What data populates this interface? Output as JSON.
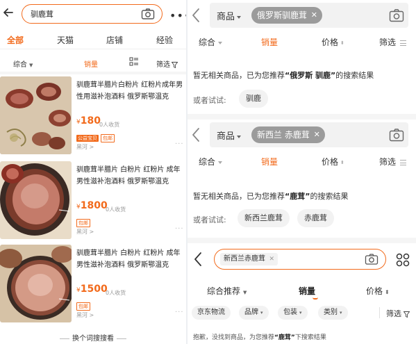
{
  "left": {
    "search_query": "驯鹿茸",
    "more_glyph": "•••",
    "tabs": [
      {
        "label": "全部",
        "active": true
      },
      {
        "label": "天猫",
        "active": false
      },
      {
        "label": "店铺",
        "active": false
      },
      {
        "label": "经验",
        "active": false
      }
    ],
    "sort": {
      "comprehensive": "综合",
      "sales": "销量",
      "filter": "筛选"
    },
    "items": [
      {
        "title": "驯鹿茸半腊片白粉片 红粉片成年男性用滋补泡酒料 俄罗斯鄂温克",
        "currency": "¥",
        "price": "180",
        "sold": "0人收货",
        "badges": [
          "公益宝贝",
          "包邮"
        ],
        "shop": "黑河 >"
      },
      {
        "title": "驯鹿茸半腊片 白粉片 红粉片 成年男性滋补泡酒料 俄罗斯鄂温克",
        "currency": "¥",
        "price": "1800",
        "sold": "0人收货",
        "badges": [
          "包邮"
        ],
        "shop": "黑河 >"
      },
      {
        "title": "驯鹿茸半腊片 白粉片 红粉片 成年男性滋补泡酒料 俄罗斯鄂温克",
        "currency": "¥",
        "price": "1500",
        "sold": "0人收货",
        "badges": [
          "包邮"
        ],
        "shop": "黑河 >"
      }
    ],
    "footer": "换个词搜搜看"
  },
  "right": {
    "section1": {
      "type_label": "商品",
      "query_pill": "俄罗斯驯鹿茸",
      "sort": {
        "comprehensive": "综合",
        "sales": "销量",
        "price": "价格",
        "filter": "筛选"
      },
      "msg_prefix": "暂无相关商品，已为您推荐",
      "msg_term": "“俄罗斯 驯鹿”",
      "msg_suffix": "的搜索结果",
      "try_label": "或者试试:",
      "suggestions": [
        "驯鹿"
      ]
    },
    "section2": {
      "type_label": "商品",
      "query_pill": "新西兰 赤鹿茸",
      "sort": {
        "comprehensive": "综合",
        "sales": "销量",
        "price": "价格",
        "filter": "筛选"
      },
      "msg_prefix": "暂无相关商品，已为您推荐",
      "msg_term": "“鹿茸”",
      "msg_suffix": "的搜索结果",
      "try_label": "或者试试:",
      "suggestions": [
        "新西兰鹿茸",
        "赤鹿茸"
      ]
    },
    "section3": {
      "query_pill": "新西兰赤鹿茸",
      "sort": {
        "comprehensive": "综合推荐",
        "sales": "销量",
        "price": "价格"
      },
      "filters": [
        "京东物流",
        "品牌",
        "包装",
        "类别"
      ],
      "filter_label": "筛选",
      "msg_prefix": "抱歉，没找到商品，为您推荐",
      "msg_term": "“鹿茸”",
      "msg_suffix": "下搜索结果"
    }
  },
  "colors": {
    "accent": "#f26a1b",
    "pill_gray": "#9b9b9b",
    "bg_light": "#f2f2f2"
  }
}
